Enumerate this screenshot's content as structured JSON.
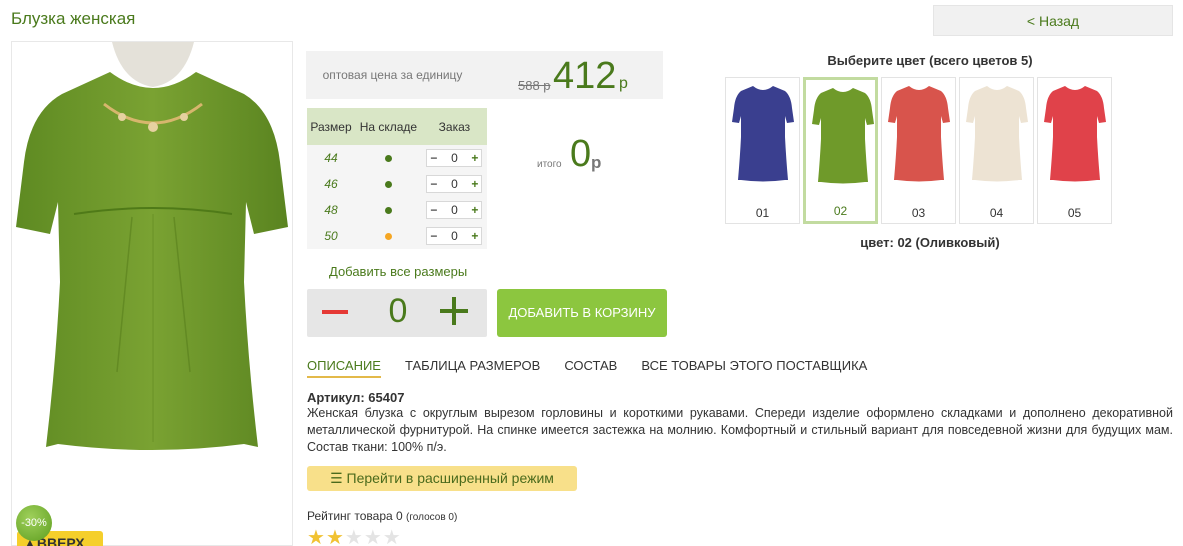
{
  "header": {
    "title": "Блузка женская",
    "back_label": "< Назад"
  },
  "product": {
    "discount": "-30%",
    "up_label": "ВВЕРХ"
  },
  "price": {
    "label": "оптовая цена за единицу",
    "old": "588 р",
    "new": "412",
    "currency": "р"
  },
  "size_table": {
    "headers": [
      "Размер",
      "На складе",
      "Заказ"
    ],
    "rows": [
      {
        "size": "44",
        "stock_color": "#4a7a1c",
        "qty": "0"
      },
      {
        "size": "46",
        "stock_color": "#4a7a1c",
        "qty": "0"
      },
      {
        "size": "48",
        "stock_color": "#4a7a1c",
        "qty": "0"
      },
      {
        "size": "50",
        "stock_color": "#f5a623",
        "qty": "0"
      }
    ]
  },
  "total": {
    "label": "итого",
    "value": "0",
    "currency": "р"
  },
  "add_all_sizes": "Добавить все размеры",
  "quantity": {
    "value": "0"
  },
  "add_to_cart": "ДОБАВИТЬ В КОРЗИНУ",
  "tabs": [
    {
      "label": "ОПИСАНИЕ",
      "active": true
    },
    {
      "label": "ТАБЛИЦА РАЗМЕРОВ",
      "active": false
    },
    {
      "label": "СОСТАВ",
      "active": false
    },
    {
      "label": "ВСЕ ТОВАРЫ ЭТОГО ПОСТАВЩИКА",
      "active": false
    }
  ],
  "description": {
    "article": "Артикул: 65407",
    "text": "Женская блузка с округлым вырезом горловины и короткими рукавами. Спереди изделие оформлено складками и дополнено декоративной металлической фурнитурой. На спинке  имеется застежка на молнию. Комфортный и стильный вариант для повседевной жизни для будущих мам. Состав ткани: 100% п/э."
  },
  "extended_mode": "Перейти в расширенный режим",
  "rating": {
    "label": "Рейтинг товара 0",
    "votes": "(голосов 0)",
    "stars": 2,
    "max": 5
  },
  "colors": {
    "title": "Выберите цвет (всего цветов 5)",
    "current": "цвет: 02 (Оливковый)",
    "items": [
      {
        "code": "01",
        "color": "#3a3f8f",
        "selected": false
      },
      {
        "code": "02",
        "color": "#6f9a2a",
        "selected": true
      },
      {
        "code": "03",
        "color": "#d8544c",
        "selected": false
      },
      {
        "code": "04",
        "color": "#ede3d3",
        "selected": false
      },
      {
        "code": "05",
        "color": "#e0424a",
        "selected": false
      }
    ]
  },
  "theme": {
    "accent": "#4a7a1c",
    "button_green": "#8cc63f",
    "yellow": "#f8e08a",
    "blouse_color": "#6f9a2a"
  }
}
